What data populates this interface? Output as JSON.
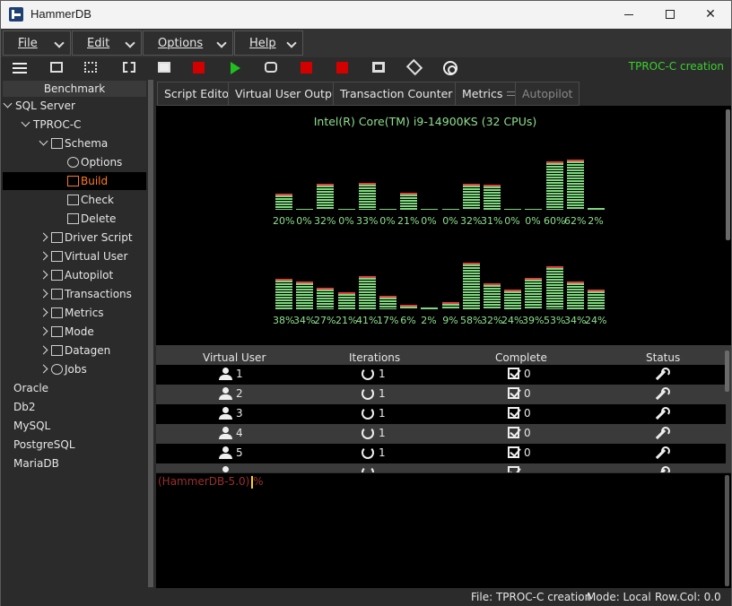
{
  "window": {
    "title": "HammerDB"
  },
  "menubar": {
    "items": [
      {
        "label": "File"
      },
      {
        "label": "Edit"
      },
      {
        "label": "Options"
      },
      {
        "label": "Help"
      }
    ]
  },
  "toolbar": {
    "status": "TPROC-C creation",
    "icons": [
      "menu-icon",
      "schema-icon",
      "load-icon",
      "delete-icon",
      "script-icon",
      "stop-icon",
      "run-icon",
      "vuser-icon",
      "stop-vuser-icon",
      "stop-counter-icon",
      "metrics-icon",
      "datagen-icon",
      "jobs-icon"
    ]
  },
  "tree": {
    "header": "Benchmark",
    "nodes": [
      {
        "label": "SQL Server"
      },
      {
        "label": "TPROC-C"
      },
      {
        "label": "Schema"
      },
      {
        "label": "Options"
      },
      {
        "label": "Build"
      },
      {
        "label": "Check"
      },
      {
        "label": "Delete"
      },
      {
        "label": "Driver Script"
      },
      {
        "label": "Virtual User"
      },
      {
        "label": "Autopilot"
      },
      {
        "label": "Transactions"
      },
      {
        "label": "Metrics"
      },
      {
        "label": "Mode"
      },
      {
        "label": "Datagen"
      },
      {
        "label": "Jobs"
      },
      {
        "label": "Oracle"
      },
      {
        "label": "Db2"
      },
      {
        "label": "MySQL"
      },
      {
        "label": "PostgreSQL"
      },
      {
        "label": "MariaDB"
      }
    ]
  },
  "tabs": [
    {
      "label": "Script Editor"
    },
    {
      "label": "Virtual User Output"
    },
    {
      "label": "Transaction Counter"
    },
    {
      "label": "Metrics"
    },
    {
      "label": "Autopilot"
    }
  ],
  "metrics": {
    "cpu_title": "Intel(R) Core(TM) i9-14900KS (32 CPUs)",
    "row1": [
      "20%",
      "0%",
      "32%",
      "0%",
      "33%",
      "0%",
      "21%",
      "0%",
      "0%",
      "32%",
      "31%",
      "0%",
      "0%",
      "60%",
      "62%",
      "2%"
    ],
    "row2": [
      "38%",
      "34%",
      "27%",
      "21%",
      "41%",
      "17%",
      "6%",
      "2%",
      "9%",
      "58%",
      "32%",
      "24%",
      "39%",
      "53%",
      "34%",
      "24%"
    ],
    "row1_values": [
      20,
      0,
      32,
      0,
      33,
      0,
      21,
      0,
      0,
      32,
      31,
      0,
      0,
      60,
      62,
      2
    ],
    "row2_values": [
      38,
      34,
      27,
      21,
      41,
      17,
      6,
      2,
      9,
      58,
      32,
      24,
      39,
      53,
      34,
      24
    ]
  },
  "vu_table": {
    "headers": [
      "Virtual User",
      "Iterations",
      "Complete",
      "Status"
    ],
    "rows": [
      {
        "user": "1",
        "iter": "1",
        "complete": "0"
      },
      {
        "user": "2",
        "iter": "1",
        "complete": "0"
      },
      {
        "user": "3",
        "iter": "1",
        "complete": "0"
      },
      {
        "user": "4",
        "iter": "1",
        "complete": "0"
      },
      {
        "user": "5",
        "iter": "1",
        "complete": "0"
      }
    ]
  },
  "console": {
    "prompt": "(HammerDB-5.0) %"
  },
  "statusbar": {
    "file": "File: TPROC-C creation",
    "mode": "Mode: Local",
    "rowcol": "Row.Col:  0.0"
  }
}
